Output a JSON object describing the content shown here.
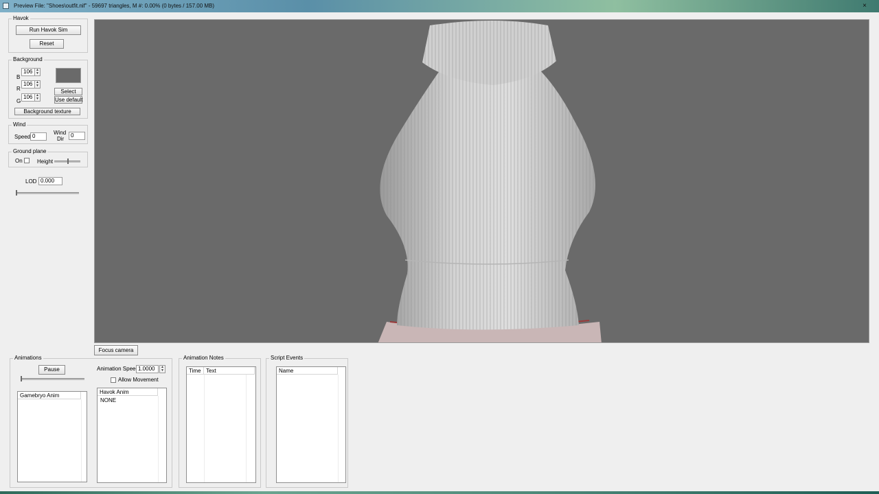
{
  "window": {
    "title": "Preview File: \"Shoes\\outfit.nif\" - 59697 triangles, M #: 0.00% (0 bytes / 157.00 MB)",
    "close_label": "×"
  },
  "havok": {
    "legend": "Havok",
    "run_label": "Run Havok Sim",
    "reset_label": "Reset"
  },
  "background": {
    "legend": "Background",
    "b_label": "B",
    "r_label": "R",
    "g_label": "G",
    "b_value": "106",
    "r_value": "106",
    "g_value": "106",
    "swatch_color": "#6a6a6a",
    "select_label": "Select",
    "default_label": "Use default",
    "texture_label": "Background texture"
  },
  "wind": {
    "legend": "Wind",
    "speed_label": "Speed",
    "speed_value": "0",
    "dir_label_1": "Wind",
    "dir_label_2": "Dir",
    "dir_value": "0"
  },
  "ground": {
    "legend": "Ground plane",
    "on_label": "On",
    "height_label": "Height"
  },
  "lod": {
    "label": "LOD",
    "value": "0.000"
  },
  "viewport": {
    "background": "#6a6a6a",
    "model_color": "#d8d8d8"
  },
  "focus_label": "Focus camera",
  "animations": {
    "legend": "Animations",
    "pause_label": "Pause",
    "speed_label": "Animation Speed",
    "speed_value": "1.0000",
    "allow_movement_label": "Allow Movement",
    "gamebryo_header": "Gamebryo Anim",
    "havok_header": "Havok Anim",
    "havok_items": [
      "NONE"
    ]
  },
  "notes": {
    "legend": "Animation Notes",
    "time_header": "Time",
    "text_header": "Text"
  },
  "events": {
    "legend": "Script Events",
    "name_header": "Name"
  }
}
